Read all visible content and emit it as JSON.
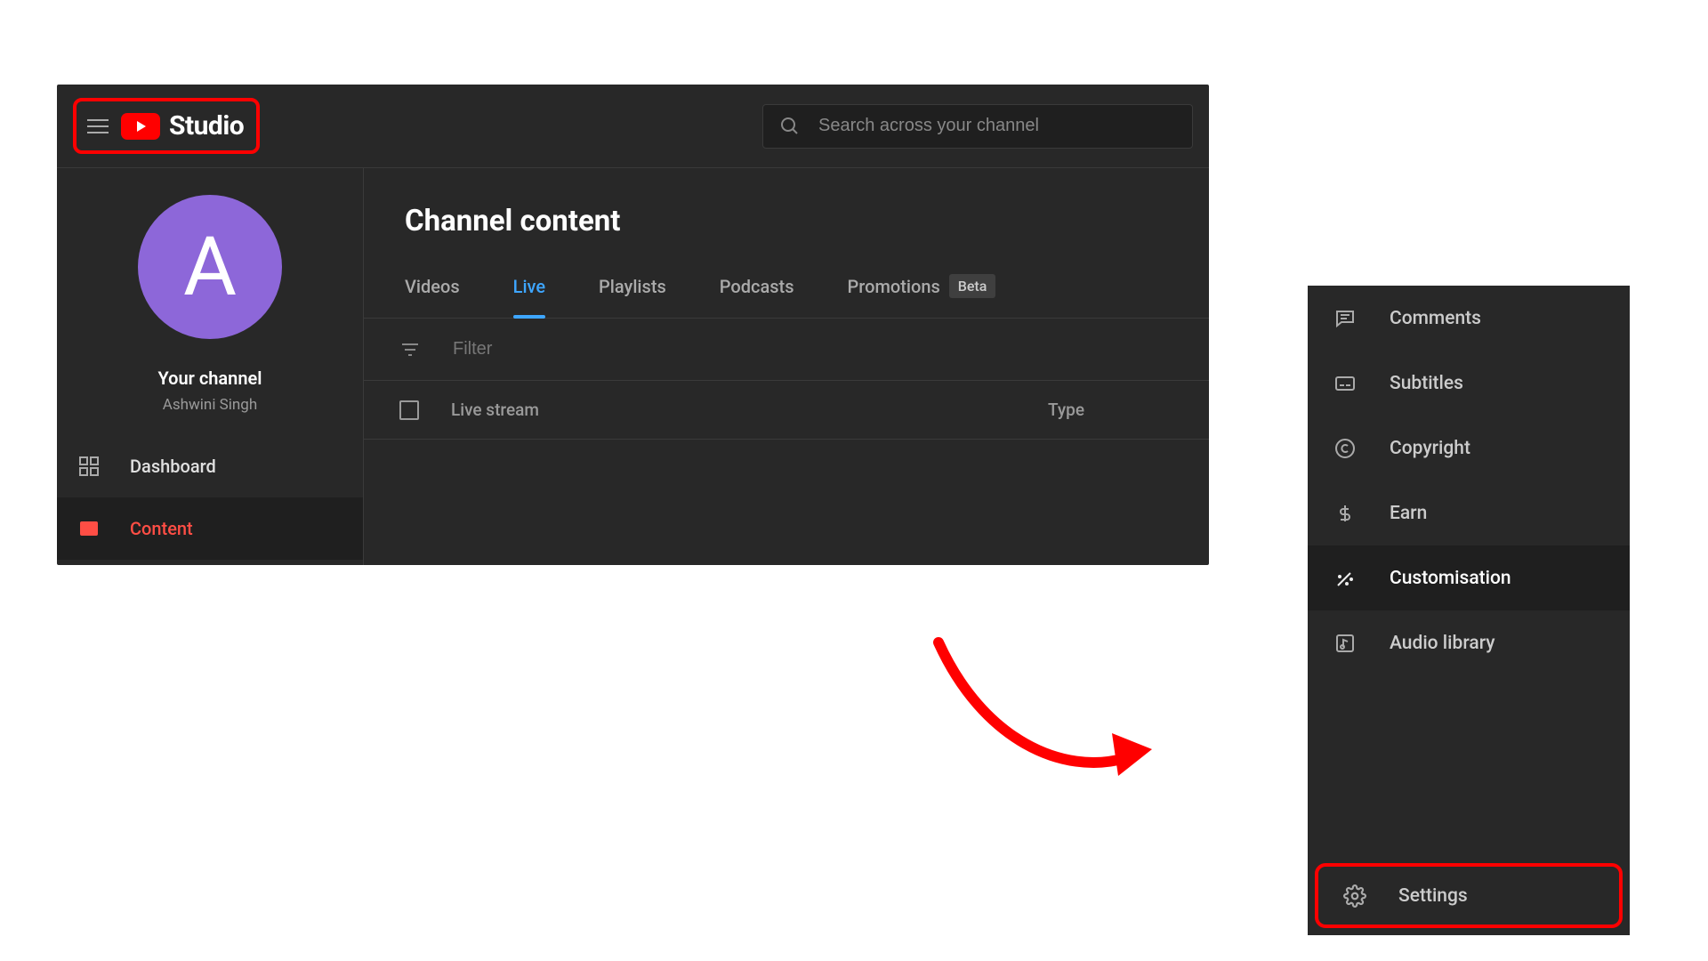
{
  "header": {
    "studio_label": "Studio",
    "search_placeholder": "Search across your channel"
  },
  "channel": {
    "avatar_letter": "A",
    "your_channel": "Your channel",
    "name": "Ashwini Singh"
  },
  "sidebar": {
    "dashboard": "Dashboard",
    "content": "Content"
  },
  "main": {
    "title": "Channel content",
    "tabs": {
      "videos": "Videos",
      "live": "Live",
      "playlists": "Playlists",
      "podcasts": "Podcasts",
      "promotions": "Promotions",
      "beta": "Beta"
    },
    "filter_placeholder": "Filter",
    "columns": {
      "live_stream": "Live stream",
      "type": "Type"
    }
  },
  "panel2": {
    "comments": "Comments",
    "subtitles": "Subtitles",
    "copyright": "Copyright",
    "earn": "Earn",
    "customisation": "Customisation",
    "audio_library": "Audio library",
    "settings": "Settings"
  }
}
